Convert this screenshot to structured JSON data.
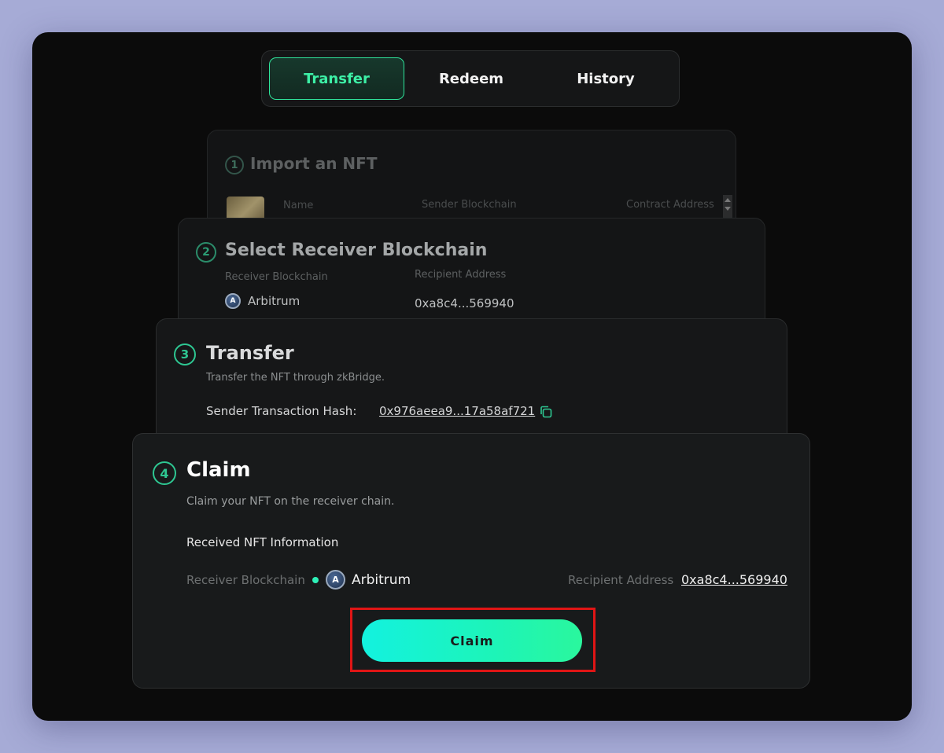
{
  "tabs": [
    {
      "label": "Transfer",
      "active": true
    },
    {
      "label": "Redeem",
      "active": false
    },
    {
      "label": "History",
      "active": false
    }
  ],
  "step1": {
    "number": "1",
    "title": "Import an NFT",
    "columns": [
      "Name",
      "Sender Blockchain",
      "Contract Address"
    ]
  },
  "step2": {
    "number": "2",
    "title": "Select Receiver Blockchain",
    "receiver_label": "Receiver Blockchain",
    "receiver_value": "Arbitrum",
    "recipient_label": "Recipient Address",
    "recipient_value": "0xa8c4...569940"
  },
  "step3": {
    "number": "3",
    "title": "Transfer",
    "subtitle": "Transfer the NFT through zkBridge.",
    "hash_label": "Sender Transaction Hash:",
    "hash_value": "0x976aeea9...17a58af721"
  },
  "step4": {
    "number": "4",
    "title": "Claim",
    "subtitle": "Claim your NFT on the receiver chain.",
    "section_label": "Received NFT Information",
    "receiver_label": "Receiver Blockchain",
    "receiver_value": "Arbitrum",
    "recipient_label": "Recipient Address",
    "recipient_value": "0xa8c4...569940",
    "button_label": "Claim"
  },
  "icons": {
    "chain": "arbitrum-icon",
    "copy": "copy-icon"
  },
  "colors": {
    "accent": "#2fe59b",
    "button_gradient_start": "#13f2df",
    "button_gradient_end": "#2af79d",
    "highlight": "#e01515"
  }
}
